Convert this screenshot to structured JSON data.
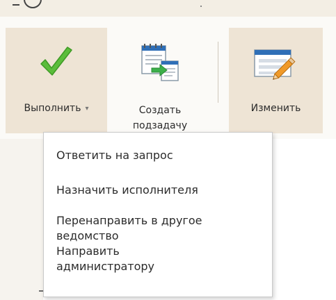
{
  "ribbon": {
    "execute": {
      "label": "Выполнить",
      "caret": "▾",
      "icon": "checkmark-icon"
    },
    "create_subtask": {
      "label_line1": "Создать",
      "label_line2": "подзадачу",
      "icon": "create-subtask-icon"
    },
    "edit": {
      "label": "Изменить",
      "icon": "edit-form-icon"
    }
  },
  "menu": {
    "items": [
      {
        "line1": "Ответить на запрос"
      },
      {
        "line1": "Назначить исполнителя"
      },
      {
        "line1": "Перенаправить в другое",
        "line2": "ведомство"
      },
      {
        "line1": "Направить",
        "line2": "администратору"
      }
    ]
  },
  "colors": {
    "ribbon_active_bg": "#eee4d5",
    "check_green": "#5bbd3b",
    "doc_blue": "#2f6fb7",
    "arrow_green": "#3cb04a",
    "pencil_orange": "#f09a2a"
  }
}
